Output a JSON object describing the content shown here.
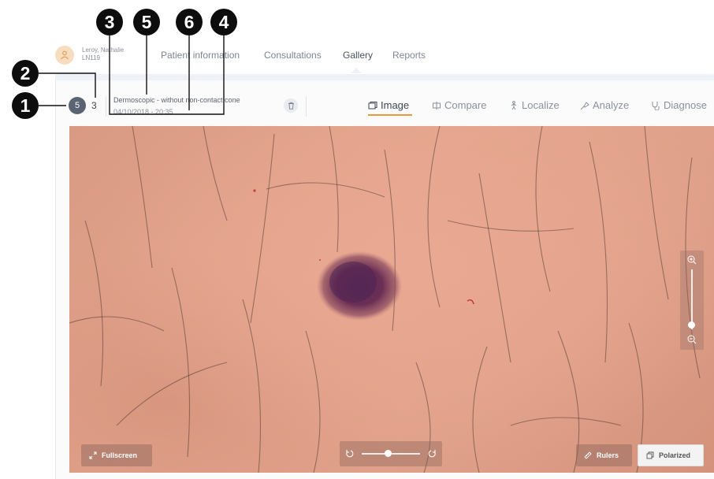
{
  "patient": {
    "name": "Leroy, Nathalie",
    "id": "LN119"
  },
  "nav": {
    "tabs": [
      "Patient information",
      "Consultations",
      "Gallery",
      "Reports"
    ],
    "active": "Gallery"
  },
  "toolbar": {
    "current_index": "5",
    "total": "3",
    "image_type": "Dermoscopic - without non-contact cone",
    "image_date": "04/10/2018 - 20:35",
    "tabs": [
      "Image",
      "Compare",
      "Localize",
      "Analyze",
      "Diagnose"
    ],
    "active_tab": "Image"
  },
  "viewer": {
    "fullscreen_label": "Fullscreen",
    "rulers_label": "Rulers",
    "polarized_label": "Polarized",
    "zoom_level": 0.08,
    "rotation_level": 0.45
  },
  "callouts": [
    "1",
    "2",
    "3",
    "5",
    "6",
    "4"
  ],
  "colors": {
    "accent": "#e79a3a",
    "badge": "#5b6472",
    "text": "#5c6370"
  },
  "icons": [
    "person-icon",
    "trash-icon",
    "image-icon",
    "compare-icon",
    "localize-icon",
    "analyze-icon",
    "diagnose-icon",
    "zoom-in-icon",
    "zoom-out-icon",
    "rotate-left-icon",
    "rotate-right-icon",
    "fullscreen-icon",
    "ruler-icon",
    "polarized-icon"
  ]
}
